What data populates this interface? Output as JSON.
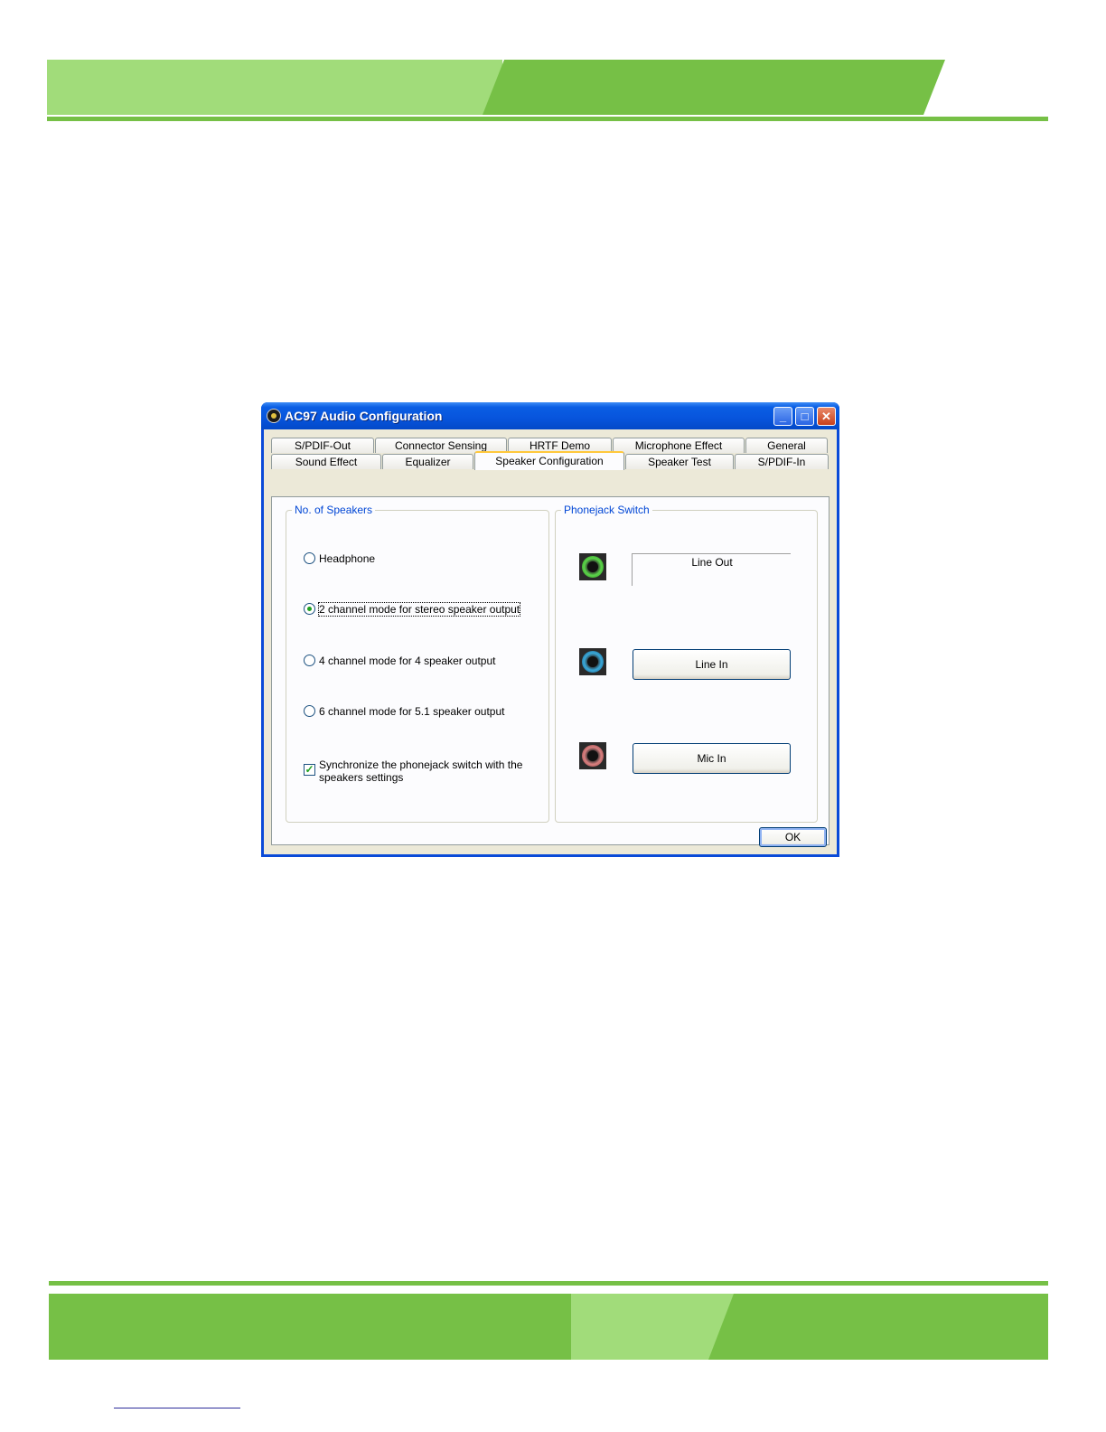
{
  "window": {
    "title": "AC97 Audio Configuration",
    "controls": {
      "minimize": "_",
      "maximize": "□",
      "close": "✕"
    }
  },
  "tabs_row1": [
    "S/PDIF-Out",
    "Connector Sensing",
    "HRTF Demo",
    "Microphone Effect",
    "General"
  ],
  "tabs_row2": [
    "Sound Effect",
    "Equalizer",
    "Speaker Configuration",
    "Speaker Test",
    "S/PDIF-In"
  ],
  "active_tab": "Speaker Configuration",
  "speakers": {
    "group_label": "No. of Speakers",
    "options": [
      {
        "label": "Headphone",
        "checked": false
      },
      {
        "label": "2 channel mode for stereo speaker output",
        "checked": true
      },
      {
        "label": "4 channel mode for 4 speaker output",
        "checked": false
      },
      {
        "label": "6 channel mode for 5.1 speaker output",
        "checked": false
      }
    ],
    "sync_checkbox": {
      "line1": "Synchronize the phonejack switch with the",
      "line2": "speakers settings",
      "checked": true
    }
  },
  "phonejack": {
    "group_label": "Phonejack Switch",
    "jacks": [
      {
        "icon": "green-jack-icon",
        "label": "Line Out",
        "color": "#5bd34a"
      },
      {
        "icon": "blue-jack-icon",
        "label": "Line In",
        "color": "#3aa8d8"
      },
      {
        "icon": "pink-jack-icon",
        "label": "Mic In",
        "color": "#d88080"
      }
    ]
  },
  "ok_label": "OK",
  "colors": {
    "brand_green": "#76c046",
    "brand_light_green": "#a1dc7a",
    "xp_blue": "#0a4ad8"
  }
}
